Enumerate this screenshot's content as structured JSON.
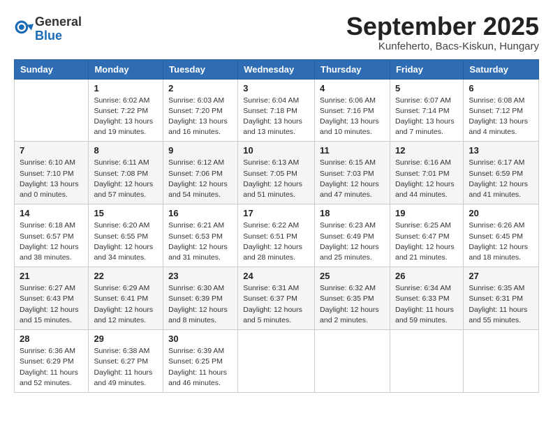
{
  "header": {
    "logo_general": "General",
    "logo_blue": "Blue",
    "month_title": "September 2025",
    "location": "Kunfeherto, Bacs-Kiskun, Hungary"
  },
  "weekdays": [
    "Sunday",
    "Monday",
    "Tuesday",
    "Wednesday",
    "Thursday",
    "Friday",
    "Saturday"
  ],
  "weeks": [
    [
      {
        "day": "",
        "info": ""
      },
      {
        "day": "1",
        "info": "Sunrise: 6:02 AM\nSunset: 7:22 PM\nDaylight: 13 hours\nand 19 minutes."
      },
      {
        "day": "2",
        "info": "Sunrise: 6:03 AM\nSunset: 7:20 PM\nDaylight: 13 hours\nand 16 minutes."
      },
      {
        "day": "3",
        "info": "Sunrise: 6:04 AM\nSunset: 7:18 PM\nDaylight: 13 hours\nand 13 minutes."
      },
      {
        "day": "4",
        "info": "Sunrise: 6:06 AM\nSunset: 7:16 PM\nDaylight: 13 hours\nand 10 minutes."
      },
      {
        "day": "5",
        "info": "Sunrise: 6:07 AM\nSunset: 7:14 PM\nDaylight: 13 hours\nand 7 minutes."
      },
      {
        "day": "6",
        "info": "Sunrise: 6:08 AM\nSunset: 7:12 PM\nDaylight: 13 hours\nand 4 minutes."
      }
    ],
    [
      {
        "day": "7",
        "info": "Sunrise: 6:10 AM\nSunset: 7:10 PM\nDaylight: 13 hours\nand 0 minutes."
      },
      {
        "day": "8",
        "info": "Sunrise: 6:11 AM\nSunset: 7:08 PM\nDaylight: 12 hours\nand 57 minutes."
      },
      {
        "day": "9",
        "info": "Sunrise: 6:12 AM\nSunset: 7:06 PM\nDaylight: 12 hours\nand 54 minutes."
      },
      {
        "day": "10",
        "info": "Sunrise: 6:13 AM\nSunset: 7:05 PM\nDaylight: 12 hours\nand 51 minutes."
      },
      {
        "day": "11",
        "info": "Sunrise: 6:15 AM\nSunset: 7:03 PM\nDaylight: 12 hours\nand 47 minutes."
      },
      {
        "day": "12",
        "info": "Sunrise: 6:16 AM\nSunset: 7:01 PM\nDaylight: 12 hours\nand 44 minutes."
      },
      {
        "day": "13",
        "info": "Sunrise: 6:17 AM\nSunset: 6:59 PM\nDaylight: 12 hours\nand 41 minutes."
      }
    ],
    [
      {
        "day": "14",
        "info": "Sunrise: 6:18 AM\nSunset: 6:57 PM\nDaylight: 12 hours\nand 38 minutes."
      },
      {
        "day": "15",
        "info": "Sunrise: 6:20 AM\nSunset: 6:55 PM\nDaylight: 12 hours\nand 34 minutes."
      },
      {
        "day": "16",
        "info": "Sunrise: 6:21 AM\nSunset: 6:53 PM\nDaylight: 12 hours\nand 31 minutes."
      },
      {
        "day": "17",
        "info": "Sunrise: 6:22 AM\nSunset: 6:51 PM\nDaylight: 12 hours\nand 28 minutes."
      },
      {
        "day": "18",
        "info": "Sunrise: 6:23 AM\nSunset: 6:49 PM\nDaylight: 12 hours\nand 25 minutes."
      },
      {
        "day": "19",
        "info": "Sunrise: 6:25 AM\nSunset: 6:47 PM\nDaylight: 12 hours\nand 21 minutes."
      },
      {
        "day": "20",
        "info": "Sunrise: 6:26 AM\nSunset: 6:45 PM\nDaylight: 12 hours\nand 18 minutes."
      }
    ],
    [
      {
        "day": "21",
        "info": "Sunrise: 6:27 AM\nSunset: 6:43 PM\nDaylight: 12 hours\nand 15 minutes."
      },
      {
        "day": "22",
        "info": "Sunrise: 6:29 AM\nSunset: 6:41 PM\nDaylight: 12 hours\nand 12 minutes."
      },
      {
        "day": "23",
        "info": "Sunrise: 6:30 AM\nSunset: 6:39 PM\nDaylight: 12 hours\nand 8 minutes."
      },
      {
        "day": "24",
        "info": "Sunrise: 6:31 AM\nSunset: 6:37 PM\nDaylight: 12 hours\nand 5 minutes."
      },
      {
        "day": "25",
        "info": "Sunrise: 6:32 AM\nSunset: 6:35 PM\nDaylight: 12 hours\nand 2 minutes."
      },
      {
        "day": "26",
        "info": "Sunrise: 6:34 AM\nSunset: 6:33 PM\nDaylight: 11 hours\nand 59 minutes."
      },
      {
        "day": "27",
        "info": "Sunrise: 6:35 AM\nSunset: 6:31 PM\nDaylight: 11 hours\nand 55 minutes."
      }
    ],
    [
      {
        "day": "28",
        "info": "Sunrise: 6:36 AM\nSunset: 6:29 PM\nDaylight: 11 hours\nand 52 minutes."
      },
      {
        "day": "29",
        "info": "Sunrise: 6:38 AM\nSunset: 6:27 PM\nDaylight: 11 hours\nand 49 minutes."
      },
      {
        "day": "30",
        "info": "Sunrise: 6:39 AM\nSunset: 6:25 PM\nDaylight: 11 hours\nand 46 minutes."
      },
      {
        "day": "",
        "info": ""
      },
      {
        "day": "",
        "info": ""
      },
      {
        "day": "",
        "info": ""
      },
      {
        "day": "",
        "info": ""
      }
    ]
  ]
}
